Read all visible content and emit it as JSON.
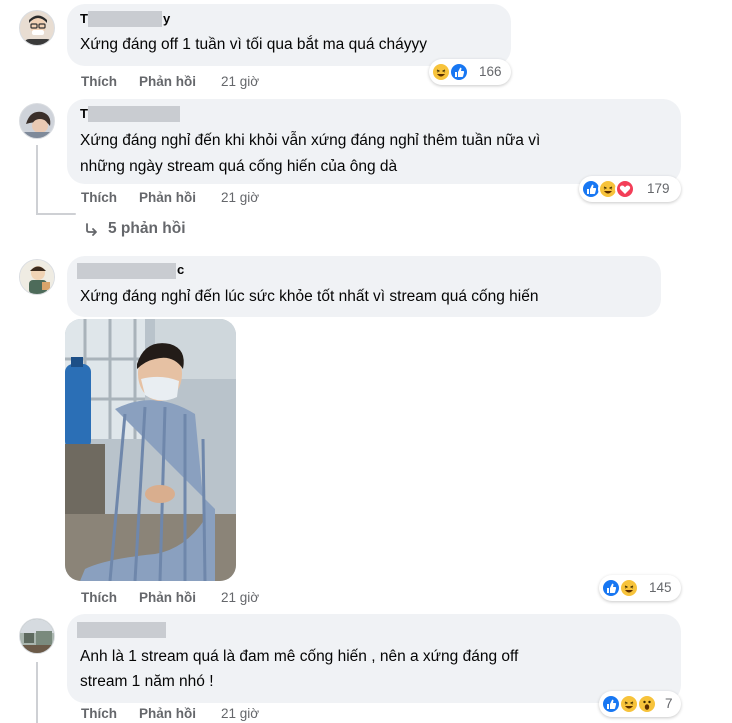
{
  "actions": {
    "like": "Thích",
    "reply": "Phản hồi"
  },
  "comments": [
    {
      "name_fragment": "T",
      "name_fragment_end": "y",
      "text": "Xứng đáng off 1 tuần vì tối qua bắt ma quá cháyyy",
      "time": "21 giờ",
      "reaction_count": "166",
      "reactions": [
        "haha-icon",
        "like-icon"
      ]
    },
    {
      "name_fragment": "T",
      "lines": [
        "Xứng đáng nghỉ đến khi khỏi vẫn xứng đáng nghỉ thêm tuần nữa vì",
        "những ngày stream quá cống hiến của ông dà"
      ],
      "time": "21 giờ",
      "reaction_count": "179",
      "reactions": [
        "like-icon",
        "haha-icon",
        "love-icon"
      ],
      "replies_label": "5 phản hồi"
    },
    {
      "name_fragment_end": "c",
      "text": "Xứng đáng nghỉ đến lúc sức khỏe tốt nhất vì stream quá cống hiến",
      "time": "21 giờ",
      "reaction_count": "145",
      "reactions": [
        "like-icon",
        "haha-icon"
      ],
      "has_photo": true
    },
    {
      "lines": [
        "Anh là 1 stream quá là đam mê cống hiến , nên a xứng đáng off",
        "stream 1 năm nhó !"
      ],
      "time": "21 giờ",
      "reaction_count": "7",
      "reactions": [
        "like-icon",
        "haha-icon",
        "wow-icon"
      ]
    }
  ],
  "colors": {
    "bubble": "#f0f2f5",
    "meta": "#65676b",
    "like": "#1877f2",
    "love": "#f33e58",
    "haha": "#f7c33b"
  }
}
